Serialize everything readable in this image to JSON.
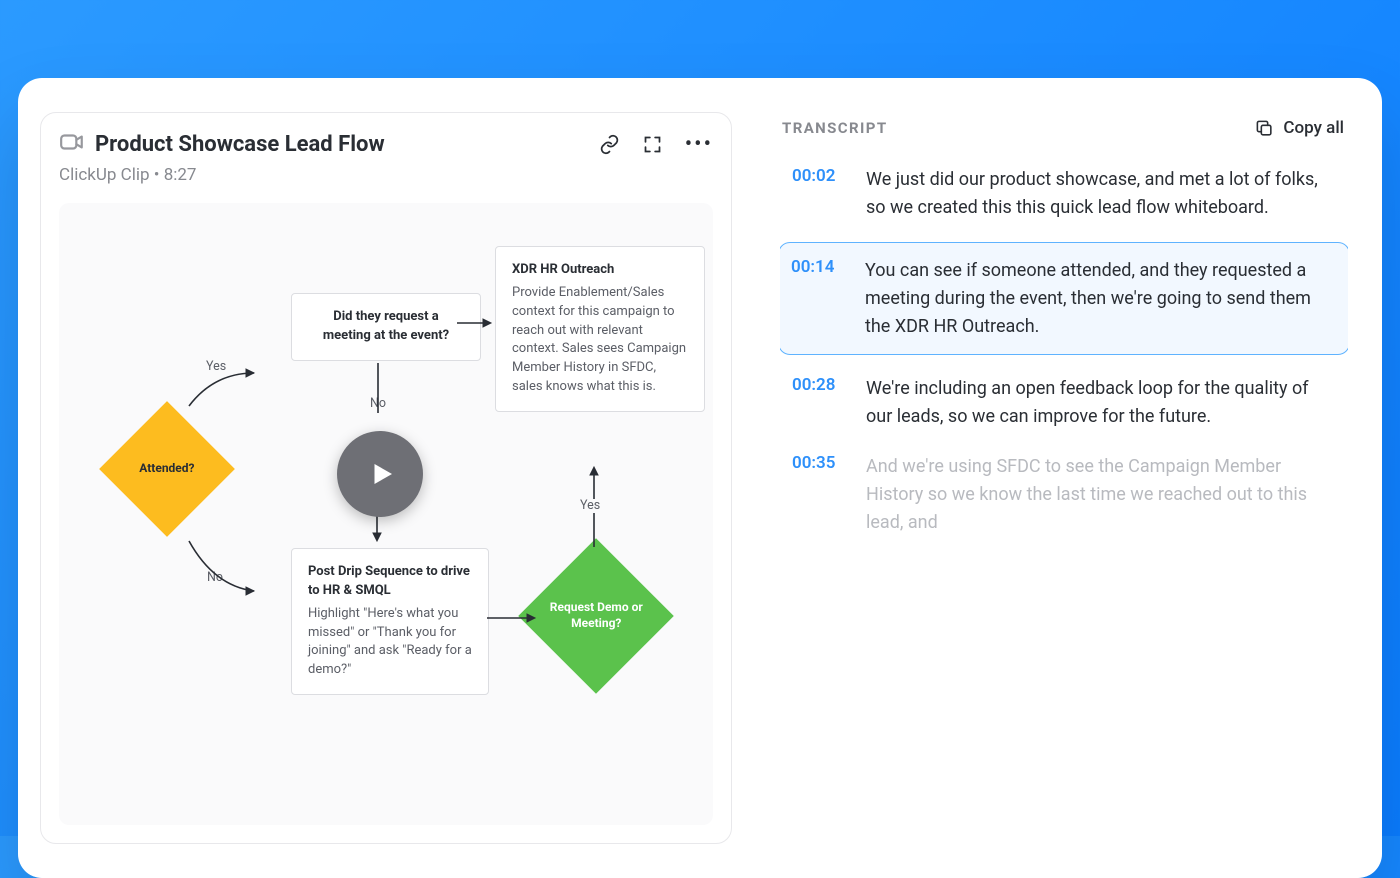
{
  "clip": {
    "title": "Product Showcase Lead Flow",
    "source": "ClickUp Clip",
    "separator": "•",
    "duration": "8:27"
  },
  "whiteboard": {
    "attended": "Attended?",
    "meeting_q": "Did they request a meeting at the event?",
    "xdr_title": "XDR HR Outreach",
    "xdr_body": "Provide Enablement/Sales context for this campaign to reach out with relevant context. Sales sees Campaign Member History in SFDC, sales knows what this is.",
    "post_title": "Post Drip Sequence to drive to HR & SMQL",
    "post_body": "Highlight \"Here's what you missed\" or \"Thank you for joining\" and ask \"Ready for a demo?\"",
    "demo_q": "Request Demo or Meeting?",
    "labels": {
      "yes": "Yes",
      "no": "No"
    }
  },
  "transcript": {
    "heading": "TRANSCRIPT",
    "copy_all": "Copy all",
    "items": [
      {
        "time": "00:02",
        "text": "We just did our product showcase, and met a lot of folks, so we created this this quick lead flow whiteboard."
      },
      {
        "time": "00:14",
        "text": "You can see if someone attended, and they requested a meeting during the event, then we're going to send them the XDR HR Outreach."
      },
      {
        "time": "00:28",
        "text": "We're including an open feedback loop for the quality of our leads, so we can improve for the future."
      },
      {
        "time": "00:35",
        "text": "And we're using SFDC to see the Campaign Member History so we know the last time we reached out to this lead, and"
      }
    ],
    "active_index": 1
  },
  "colors": {
    "accent_blue": "#2E90FA",
    "diamond_yellow": "#FDBC1F",
    "diamond_green": "#5BC24C"
  }
}
